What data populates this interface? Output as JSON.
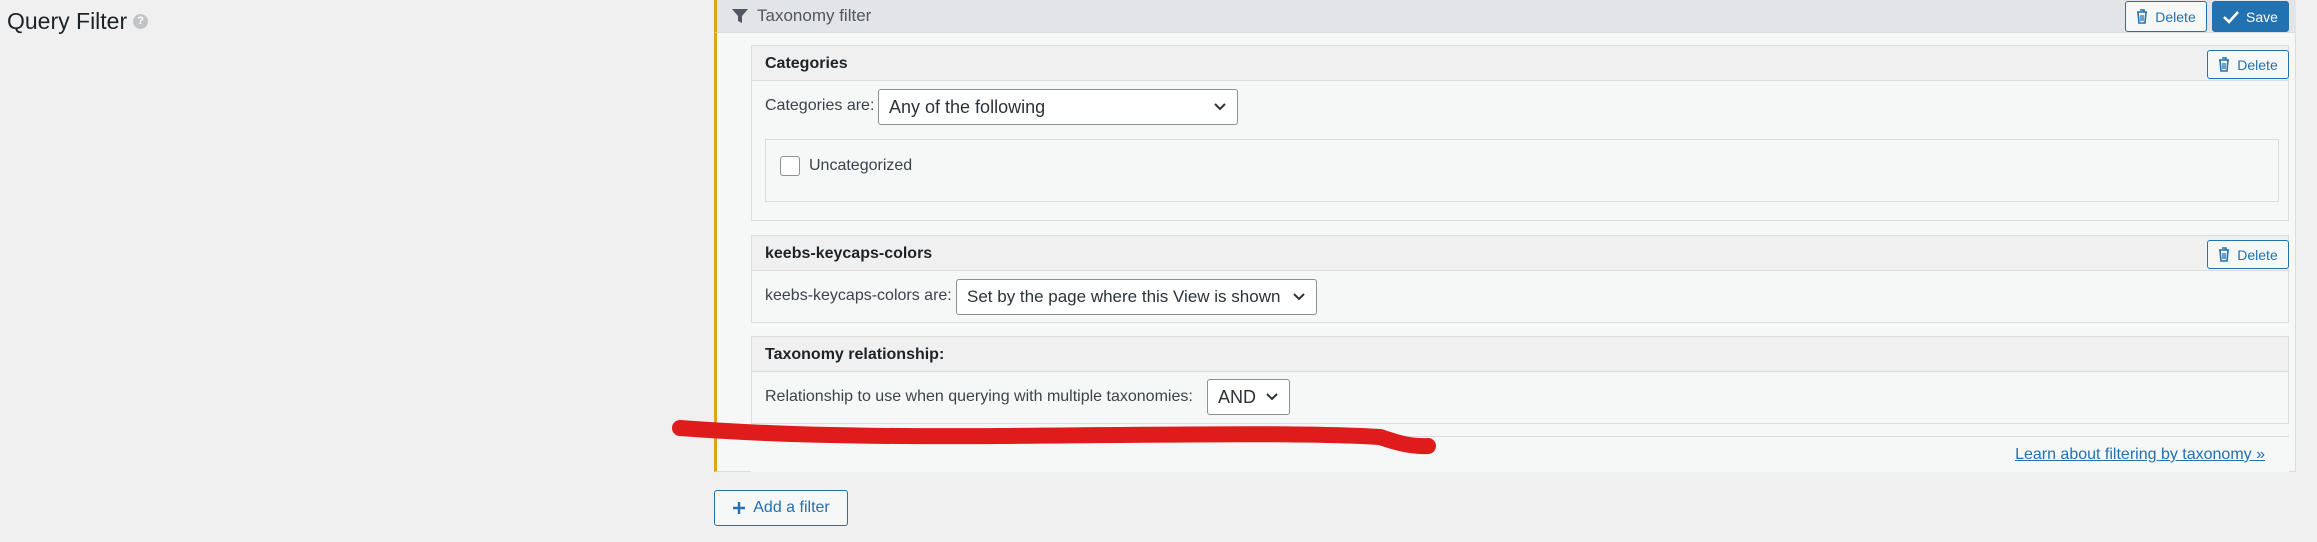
{
  "section": {
    "title": "Query Filter",
    "help_glyph": "?"
  },
  "header": {
    "title": "Taxonomy filter",
    "delete_label": "Delete",
    "save_label": "Save"
  },
  "categories": {
    "heading": "Categories",
    "delete_label": "Delete",
    "field_label": "Categories are:",
    "selected": "Any of the following",
    "items": [
      {
        "label": "Uncategorized",
        "checked": false
      }
    ]
  },
  "keycaps": {
    "heading": "keebs-keycaps-colors",
    "delete_label": "Delete",
    "field_label": "keebs-keycaps-colors are:",
    "selected": "Set by the page where this View is shown"
  },
  "relationship": {
    "heading": "Taxonomy relationship:",
    "field_label": "Relationship to use when querying with multiple taxonomies:",
    "selected": "AND"
  },
  "learn_link": "Learn about filtering by taxonomy »",
  "add_filter_label": "Add a filter",
  "colors": {
    "accent": "#2271b1",
    "panel_border": "#dba617",
    "annotation": "#e01b1b"
  },
  "icons": [
    "help-icon",
    "funnel-icon",
    "trash-icon",
    "checkmark-icon",
    "chevron-down-icon",
    "plus-icon"
  ]
}
